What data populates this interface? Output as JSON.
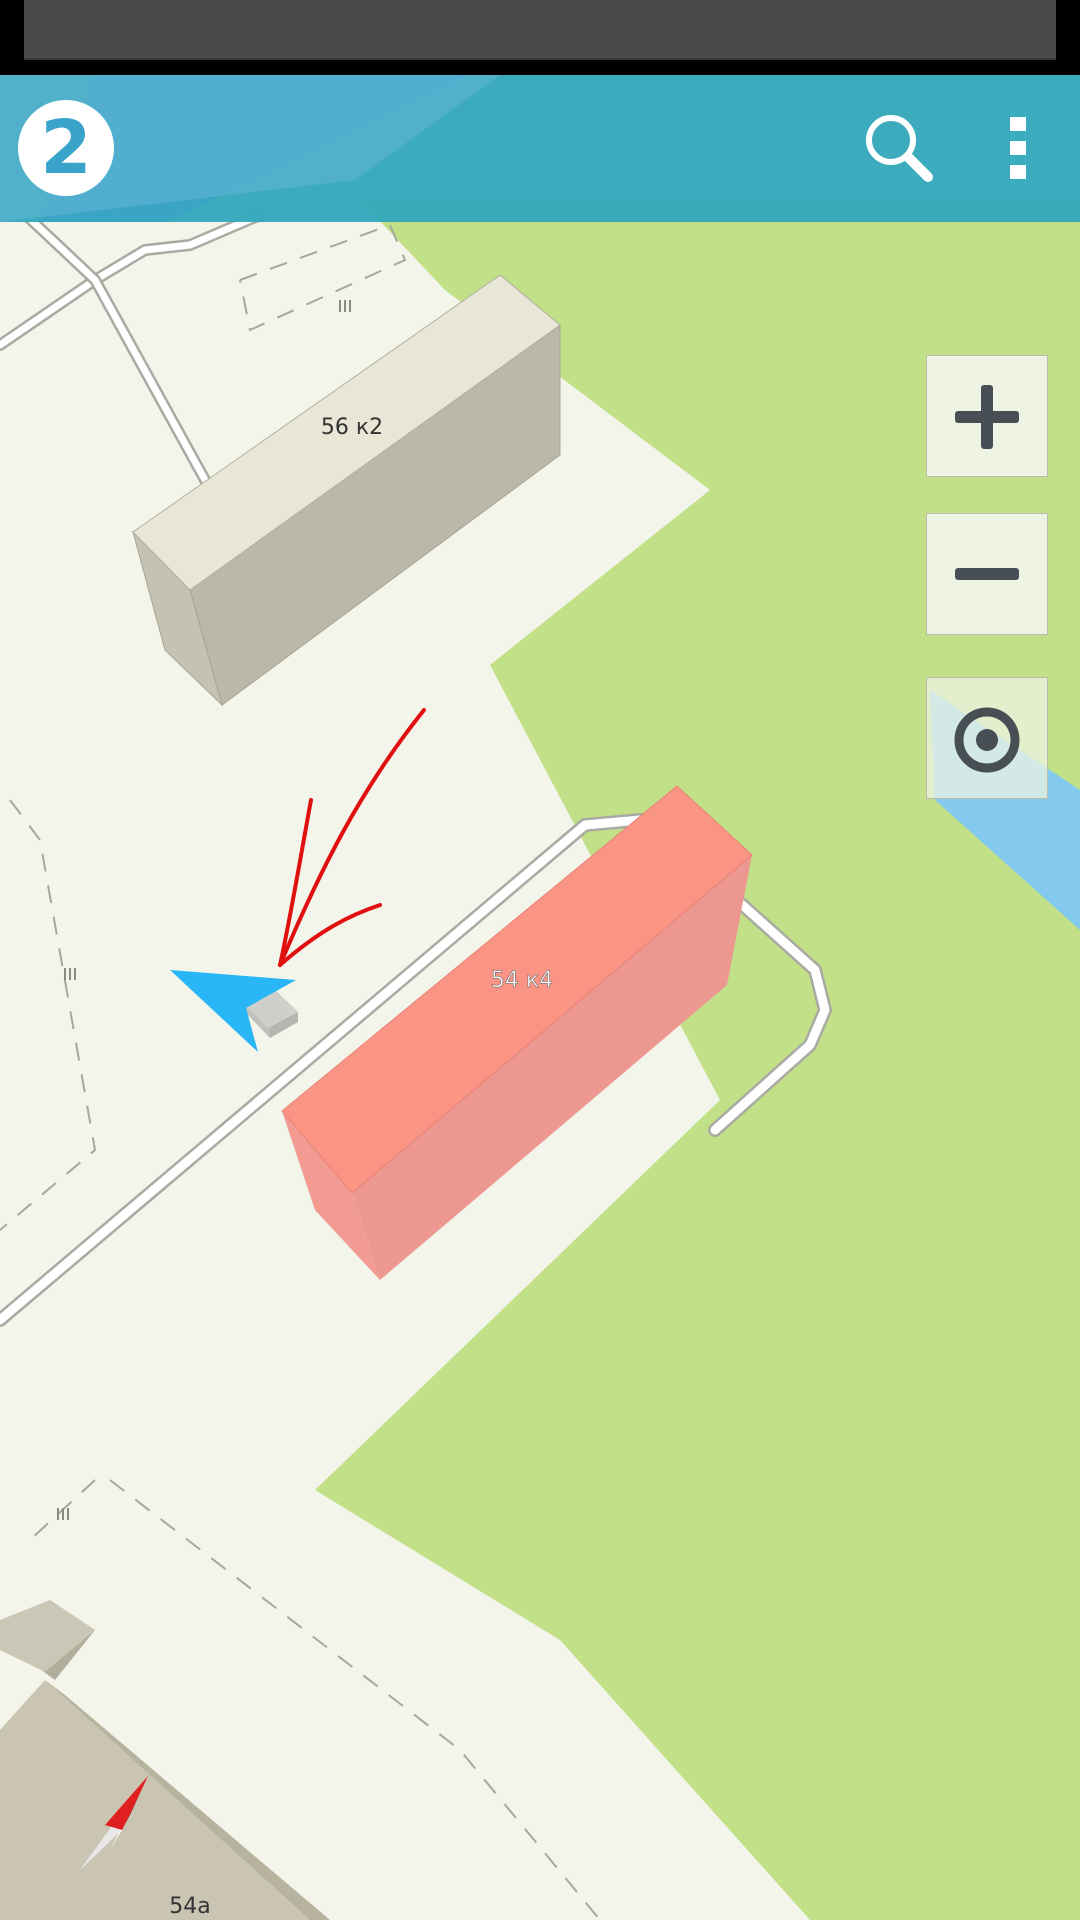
{
  "app": {
    "logo_text": "2",
    "brand_color": "#30a6bb"
  },
  "toolbar": {
    "search_icon": "search-icon",
    "menu_icon": "more-vert-icon"
  },
  "map_controls": {
    "zoom_in_icon": "plus-icon",
    "zoom_out_icon": "minus-icon",
    "locate_icon": "target-icon"
  },
  "map": {
    "colors": {
      "land": "#f3f4ea",
      "park": "#c2e088",
      "water": "#84c9ee",
      "highlighted_building": "#fa9484",
      "building": "#d6d4c3",
      "location_arrow": "#29b6f6",
      "annotation_arrow": "#e01010"
    },
    "buildings": {
      "b1": "56 к2",
      "b2": "54 к4",
      "b3": "54а"
    }
  },
  "compass": {
    "icon": "compass-icon"
  }
}
